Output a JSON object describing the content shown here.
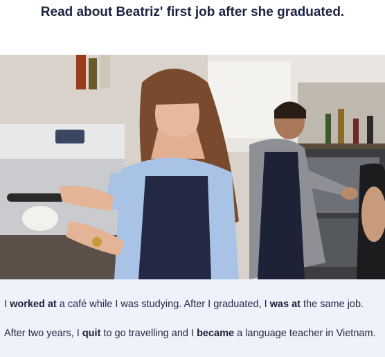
{
  "heading": "Read about Beatriz' first job after she graduated.",
  "image": {
    "icon": "photo-barista-at-coffee-machine"
  },
  "paragraphs": [
    {
      "segments": [
        {
          "text": "I ",
          "bold": false
        },
        {
          "text": "worked at",
          "bold": true
        },
        {
          "text": " a café while I was studying. After I graduated, I ",
          "bold": false
        },
        {
          "text": "was at",
          "bold": true
        },
        {
          "text": " the same job.",
          "bold": false
        }
      ]
    },
    {
      "segments": [
        {
          "text": "After two years, I ",
          "bold": false
        },
        {
          "text": "quit",
          "bold": true
        },
        {
          "text": " to go travelling and I ",
          "bold": false
        },
        {
          "text": "became",
          "bold": true
        },
        {
          "text": " a language teacher in Vietnam.",
          "bold": false
        }
      ]
    }
  ],
  "colors": {
    "heading": "#1c2240",
    "text_panel_bg": "#eef2fa"
  }
}
